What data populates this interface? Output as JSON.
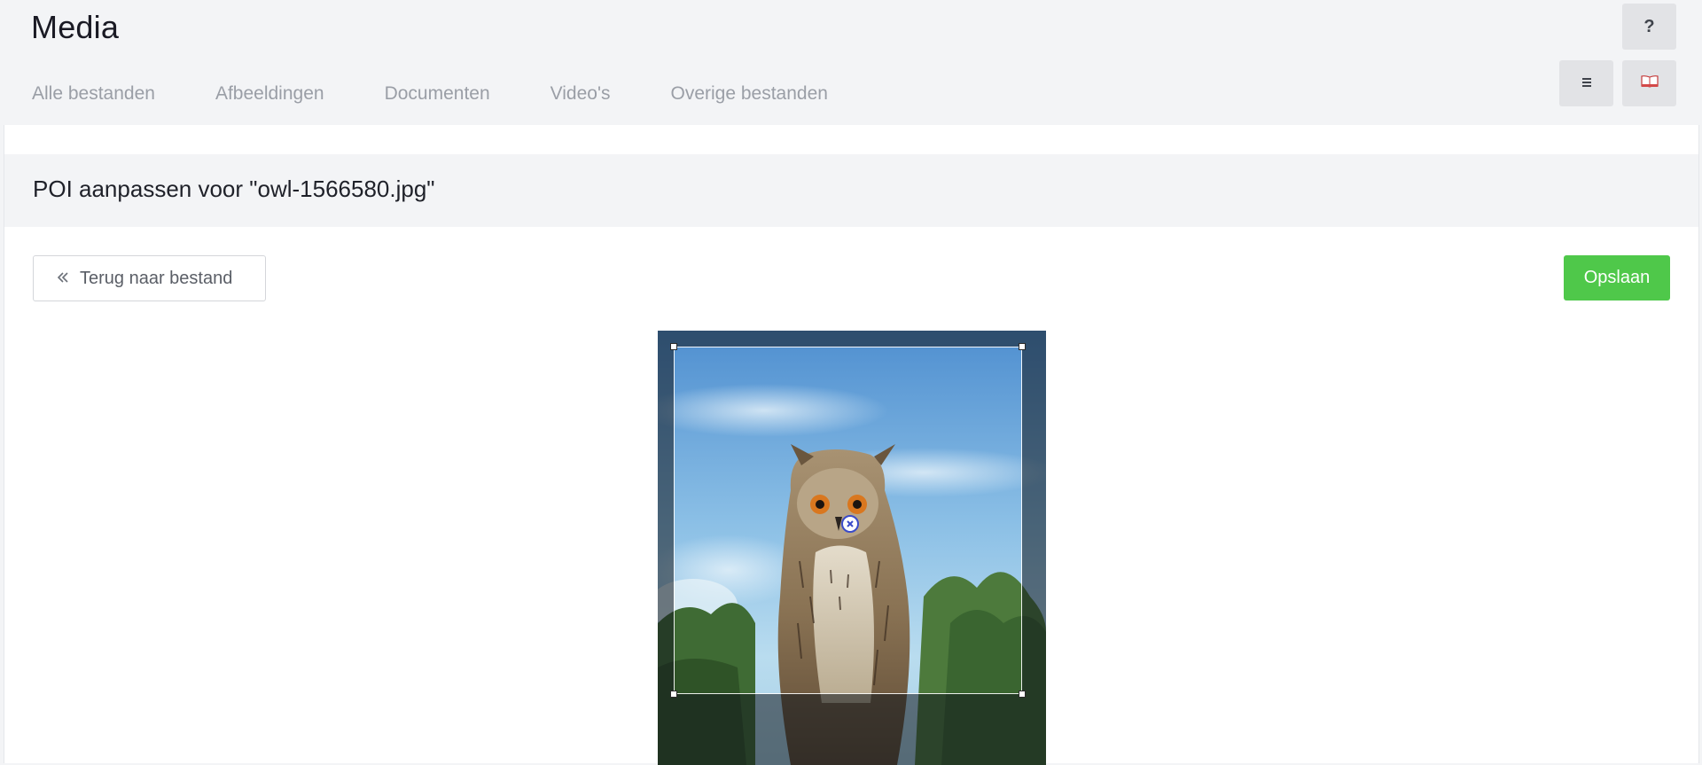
{
  "app": {
    "title": "Media"
  },
  "tabs": [
    {
      "label": "Alle bestanden"
    },
    {
      "label": "Afbeeldingen"
    },
    {
      "label": "Documenten"
    },
    {
      "label": "Video's"
    },
    {
      "label": "Overige bestanden"
    }
  ],
  "toolbar": {
    "help_label": "?",
    "menu_icon": "list-icon",
    "book_icon": "book-icon"
  },
  "section": {
    "title": "POI aanpassen voor \"owl-1566580.jpg\""
  },
  "actions": {
    "back_label": "Terug naar bestand",
    "back_icon": "double-chevron-left-icon",
    "save_label": "Opslaan"
  },
  "editor": {
    "image_subject": "owl",
    "poi_icon": "close-circle-icon"
  },
  "colors": {
    "accent_green": "#4fc84a",
    "poi_blue": "#3a4bc9",
    "background": "#f3f4f6"
  }
}
